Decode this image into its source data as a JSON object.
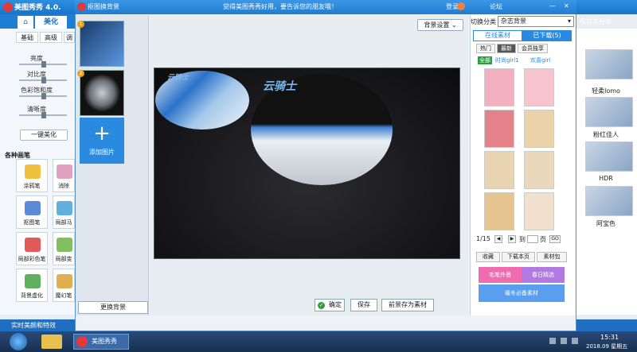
{
  "main_app": {
    "title": "美图秀秀 4.0.",
    "tabs": {
      "home": "⌂",
      "beautify": "美化"
    },
    "subtabs": [
      "基础",
      "高级",
      "调"
    ],
    "sliders": [
      "亮度",
      "对比度",
      "色彩饱和度",
      "清晰度"
    ],
    "one_key_label": "一键美化",
    "brushes_title": "各种画笔",
    "tools": [
      "涂鸦笔",
      "消除",
      "抠图笔",
      "局部马",
      "局部彩色笔",
      "局部变",
      "背景虚化",
      "魔幻笔"
    ],
    "right_labels": [
      "轻柔lomo",
      "粉红佳人",
      "HDR",
      "阿宝色"
    ],
    "status_left": "实时美颜和特效",
    "right_top": "保存与分享"
  },
  "dialog": {
    "title": "抠图换背景",
    "banner": "觉得美图秀秀好用，要告诉您的朋友哦！",
    "login": "登录",
    "forum": "论坛",
    "minimize": "最小化",
    "status_text": "实时美颜和特效"
  },
  "thumb_strip": {
    "badges": [
      "1",
      "2"
    ],
    "add_label": "添加图片",
    "add_plus": "+",
    "replace_label": "更换背景"
  },
  "canvas": {
    "settings_label": "背景设置",
    "watermark": "云骑士",
    "watermark_small": "云骑士"
  },
  "actions": {
    "ok": "确定",
    "save": "保存",
    "save_as_material": "前景存为素材"
  },
  "material_panel": {
    "switch_label": "切换分类",
    "switch_value": "杂志背景",
    "tab_online": "在线素材",
    "tab_downloaded": "已下载(5)",
    "filter_tabs": [
      "热门",
      "最新",
      "会员独享"
    ],
    "sub_filters": [
      "全部",
      "时尚girl1",
      "欢喜girl"
    ],
    "pager": "1/15",
    "pager_to": "到",
    "pager_page": "页",
    "pager_go": "GO",
    "btn_favorite": "收藏",
    "btn_download": "下载本页",
    "btn_pack": "素材包",
    "promo1": "毛笔外景",
    "promo2": "春日精选",
    "promo3": "暖冬必备素材"
  },
  "taskbar": {
    "app_label": "美图秀秀",
    "time": "15:31",
    "date": "2018.09 星期五"
  },
  "colors": {
    "accent": "#1f7cd0",
    "canvas_bg": "#0c0c0e",
    "promo_pink": "#f06cb0"
  }
}
